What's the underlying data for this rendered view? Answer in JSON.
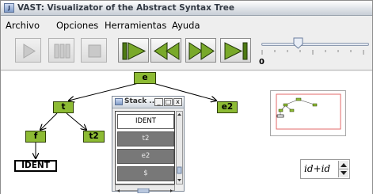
{
  "window": {
    "title": "VAST: Visualizator of the Abstract Syntax Tree",
    "app_icon": "J"
  },
  "menu": {
    "items": [
      "Archivo",
      "Opciones",
      "Herramientas",
      "Ayuda"
    ]
  },
  "toolbar": {
    "buttons": [
      {
        "name": "play-icon",
        "enabled": false
      },
      {
        "name": "pause-icon",
        "enabled": false
      },
      {
        "name": "stop-icon",
        "enabled": false
      },
      {
        "name": "step-first-icon",
        "enabled": true
      },
      {
        "name": "rewind-icon",
        "enabled": true
      },
      {
        "name": "fast-forward-icon",
        "enabled": true
      },
      {
        "name": "step-last-icon",
        "enabled": true
      }
    ],
    "slider_value": "0"
  },
  "tree": {
    "nodes": {
      "e": "e",
      "t": "t",
      "e2": "e2",
      "f": "f",
      "t2": "t2"
    },
    "leaf": "IDENT"
  },
  "stack": {
    "title": "Stack ...",
    "controls": [
      "_",
      "□",
      "x"
    ],
    "items": [
      "IDENT",
      "t2",
      "e2",
      "$"
    ]
  },
  "formula": {
    "text": "id+id"
  },
  "colors": {
    "node_fill": "#8dbb34",
    "accent": "#4d7a12",
    "stack_gray": "#787878"
  }
}
